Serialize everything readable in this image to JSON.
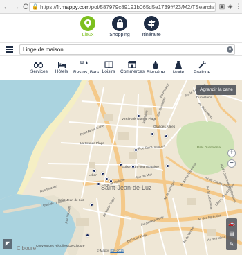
{
  "browser": {
    "back": "←",
    "forward": "→",
    "reload": "C",
    "url_prefix": "https://",
    "url_host": "fr.mappy.com",
    "url_path": "/poi/587979c89191b065d5e1739#/23/M2/TSearch/SLinge+de",
    "bookmark": "☆"
  },
  "modes": [
    {
      "label": "Lieux",
      "icon": "pin-icon",
      "active": true
    },
    {
      "label": "Shopping",
      "icon": "bag-icon",
      "active": false
    },
    {
      "label": "Itinéraire",
      "icon": "signpost-icon",
      "active": false
    }
  ],
  "search": {
    "value": "Linge de maison",
    "clear": "×"
  },
  "categories": [
    {
      "label": "Services",
      "icon": "binoculars-icon"
    },
    {
      "label": "Hôtels",
      "icon": "bed-icon"
    },
    {
      "label": "Restos, Bars",
      "icon": "cutlery-icon"
    },
    {
      "label": "Loisirs",
      "icon": "book-icon"
    },
    {
      "label": "Commerces",
      "icon": "shop-icon"
    },
    {
      "label": "Bien-être",
      "icon": "bottle-icon"
    },
    {
      "label": "Mode",
      "icon": "dress-icon"
    },
    {
      "label": "Pratique",
      "icon": "wrench-icon"
    }
  ],
  "map": {
    "enlarge_label": "Agrandir la carte",
    "zoom_in": "+",
    "zoom_out": "−",
    "city": "Saint-Jean-de-Luz",
    "ciboure": "Ciboure",
    "copyright_prefix": "© Mappy",
    "copyright_link": "IGN-2016",
    "places": [
      "Vinci Park Grande Plage",
      "Grandes Allées",
      "Parc Ducontenia",
      "La Grande Plage",
      "Eglise Saint-Jean-Baptiste",
      "Saint-Jean-de-Luz",
      "Couvent des Récollets De Ciboure",
      "Ducontenia",
      "Lebon"
    ],
    "streets": [
      "Bd Thiers",
      "Rue Gambetta",
      "Bd Victor Hugo",
      "Av Jaureguiberry",
      "Rue Mazarin",
      "Bd Pasteur",
      "Av de Verdun",
      "Rue de l'Infante",
      "Quai de l'Infante",
      "Rue Marion Garay",
      "Rue du Midi",
      "Rue Saint-Jacques",
      "Av de Larreguy",
      "Bd du Cdt Passicot",
      "Av André Ithurralde",
      "Chem. de Lassegue",
      "Rue Vauban",
      "Av des Pyrénées",
      "Av de Habas",
      "Av de Bordagain",
      "Bd du Commandant Passicot",
      "Av Ducontenia",
      "Av de Lafontaine",
      "Bd Victor Hugo"
    ]
  },
  "colors": {
    "accent_green": "#7cbf1f",
    "navy": "#1e2c44",
    "sea": "#aad3df",
    "land": "#efe7d6",
    "park": "#cde2b4",
    "road_major": "#f4c98a",
    "pin": "#13245a"
  }
}
